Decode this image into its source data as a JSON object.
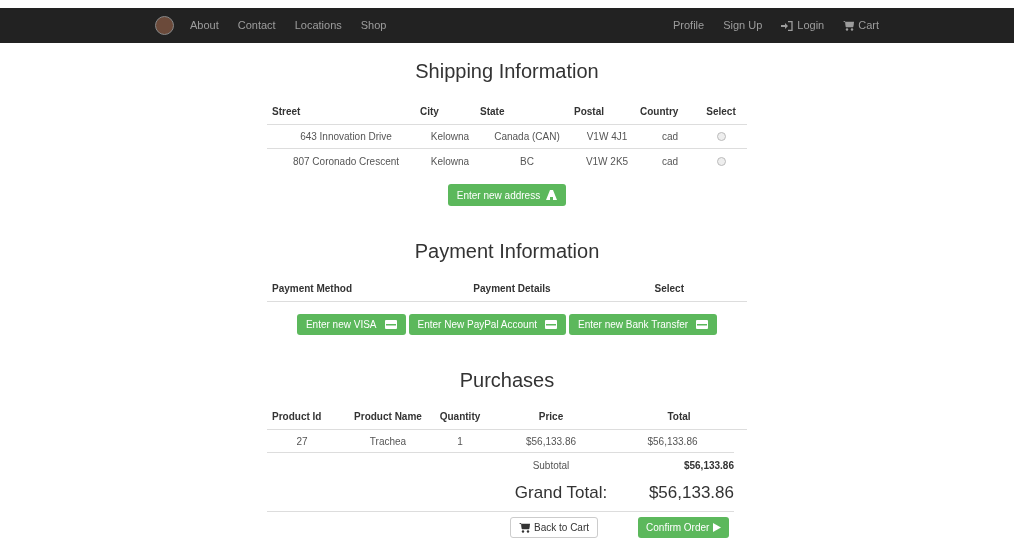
{
  "navbar": {
    "left_links": [
      "About",
      "Contact",
      "Locations",
      "Shop"
    ],
    "right_links": [
      {
        "label": "Profile",
        "kind": "text"
      },
      {
        "label": "Sign Up",
        "kind": "text"
      },
      {
        "label": "Login",
        "kind": "login"
      },
      {
        "label": "Cart",
        "kind": "cart"
      }
    ]
  },
  "shipping": {
    "title": "Shipping Information",
    "columns": [
      "Street",
      "City",
      "State",
      "Postal",
      "Country",
      "Select"
    ],
    "rows": [
      {
        "street": "643 Innovation Drive",
        "city": "Kelowna",
        "state": "Canada (CAN)",
        "postal": "V1W 4J1",
        "country": "cad",
        "selected": false
      },
      {
        "street": "807 Coronado Crescent",
        "city": "Kelowna",
        "state": "BC",
        "postal": "V1W 2K5",
        "country": "cad",
        "selected": false
      }
    ],
    "new_address_button": "Enter new address"
  },
  "payment": {
    "title": "Payment Information",
    "columns": [
      "Payment Method",
      "Payment Details",
      "Select"
    ],
    "buttons": [
      "Enter new VISA",
      "Enter New PayPal Account",
      "Enter new Bank Transfer"
    ]
  },
  "purchases": {
    "title": "Purchases",
    "columns": [
      "Product Id",
      "Product Name",
      "Quantity",
      "Price",
      "Total"
    ],
    "rows": [
      {
        "id": "27",
        "name": "Trachea",
        "quantity": "1",
        "price": "$56,133.86",
        "total": "$56,133.86"
      }
    ],
    "subtotal_label": "Subtotal",
    "subtotal": "$56,133.86",
    "grand_total_label": "Grand Total:",
    "grand_total": "$56,133.86",
    "back_button": "Back to Cart",
    "confirm_button": "Confirm Order"
  }
}
